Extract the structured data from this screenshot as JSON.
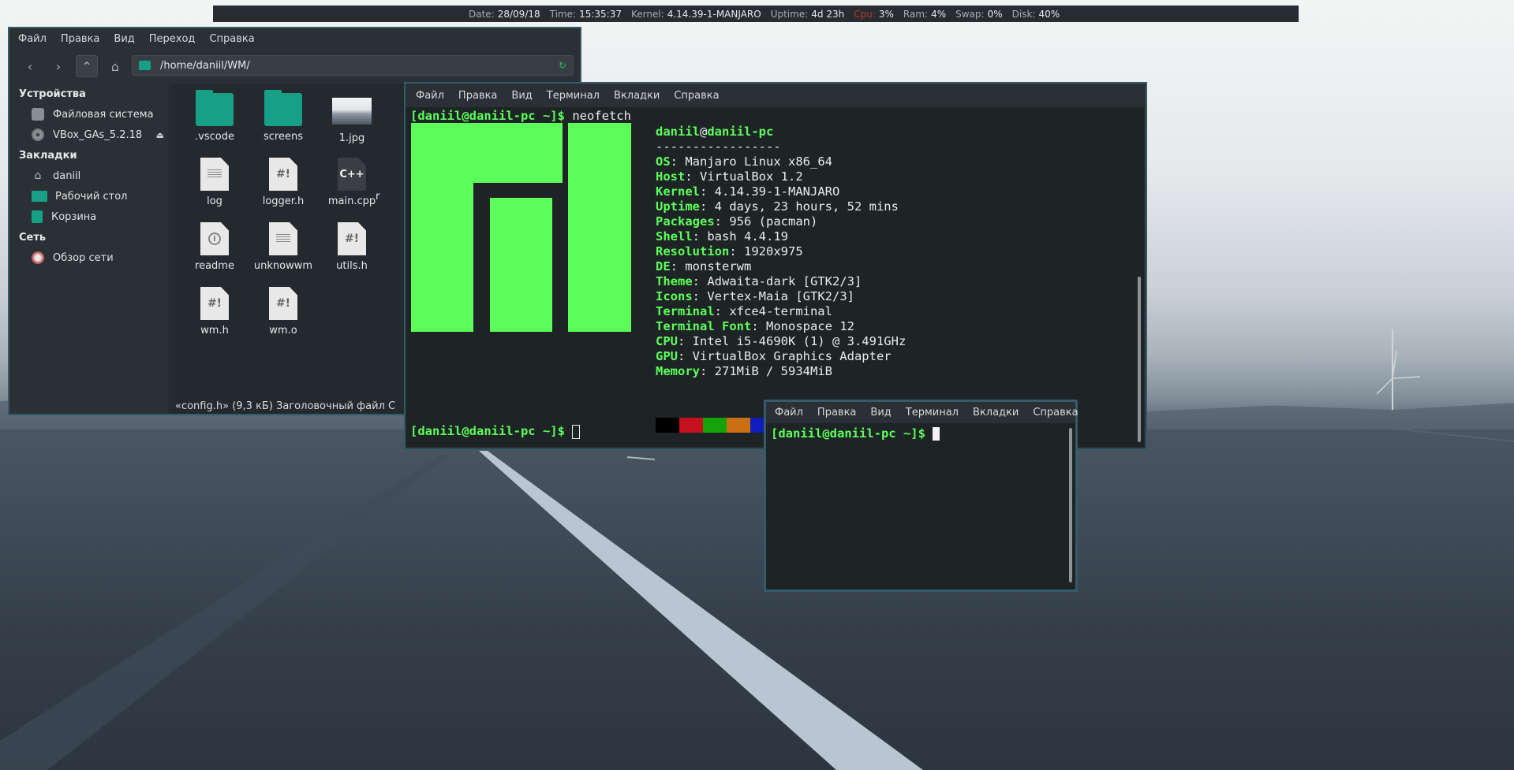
{
  "statusbar": {
    "date_label": "Date:",
    "date": "28/09/18",
    "time_label": "Time:",
    "time": "15:35:37",
    "kernel_label": "Kernel:",
    "kernel": "4.14.39-1-MANJARO",
    "uptime_label": "Uptime:",
    "uptime": "4d 23h",
    "cpu_label": "Cpu:",
    "cpu": "3%",
    "ram_label": "Ram:",
    "ram": "4%",
    "swap_label": "Swap:",
    "swap": "0%",
    "disk_label": "Disk:",
    "disk": "40%",
    "colors": {
      "background": "#272c31",
      "cpu_label": "#b8382f"
    }
  },
  "file_manager": {
    "menu": [
      "Файл",
      "Правка",
      "Вид",
      "Переход",
      "Справка"
    ],
    "toolbar_icons": [
      "back-icon",
      "forward-icon",
      "up-icon",
      "home-icon"
    ],
    "path": "/home/daniil/WM/",
    "sidebar": {
      "devices_title": "Устройства",
      "devices": [
        {
          "label": "Файловая система",
          "icon": "disk-icon"
        },
        {
          "label": "VBox_GAs_5.2.18",
          "icon": "cdrom-icon"
        }
      ],
      "bookmarks_title": "Закладки",
      "bookmarks": [
        {
          "label": "daniil",
          "icon": "home-icon"
        },
        {
          "label": "Рабочий стол",
          "icon": "desktop-icon"
        },
        {
          "label": "Корзина",
          "icon": "trash-icon"
        }
      ],
      "network_title": "Сеть",
      "network": [
        {
          "label": "Обзор сети",
          "icon": "network-icon"
        }
      ]
    },
    "files": [
      {
        "name": ".vscode",
        "icon": "folder-icon"
      },
      {
        "name": "screens",
        "icon": "folder-icon"
      },
      {
        "name": "1.jpg",
        "icon": "image-icon"
      },
      {
        "name": "log",
        "icon": "text-file-icon"
      },
      {
        "name": "logger.h",
        "icon": "script-file-icon",
        "glyph": "#!"
      },
      {
        "name": "main.cpp",
        "icon": "cpp-file-icon",
        "glyph": "C++"
      },
      {
        "name": "readme",
        "icon": "info-file-icon"
      },
      {
        "name": "unknowwm",
        "icon": "text-file-icon"
      },
      {
        "name": "utils.h",
        "icon": "script-file-icon",
        "glyph": "#!"
      },
      {
        "name": "wm.h",
        "icon": "script-file-icon",
        "glyph": "#!"
      },
      {
        "name": "wm.o",
        "icon": "script-file-icon",
        "glyph": "#!"
      }
    ],
    "partial_label": "r",
    "status": "«config.h» (9,3 кБ) Заголовочный файл C"
  },
  "terminal_main": {
    "menu": [
      "Файл",
      "Правка",
      "Вид",
      "Терминал",
      "Вкладки",
      "Справка"
    ],
    "prompt": "[daniil@daniil-pc ~]$",
    "command": "neofetch",
    "neofetch": {
      "user": "daniil",
      "at": "@",
      "host": "daniil-pc",
      "separator": "-----------------",
      "fields": [
        {
          "key": "OS",
          "value": "Manjaro Linux x86_64"
        },
        {
          "key": "Host",
          "value": "VirtualBox 1.2"
        },
        {
          "key": "Kernel",
          "value": "4.14.39-1-MANJARO"
        },
        {
          "key": "Uptime",
          "value": "4 days, 23 hours, 52 mins"
        },
        {
          "key": "Packages",
          "value": "956 (pacman)"
        },
        {
          "key": "Shell",
          "value": "bash 4.4.19"
        },
        {
          "key": "Resolution",
          "value": "1920x975"
        },
        {
          "key": "DE",
          "value": "monsterwm"
        },
        {
          "key": "Theme",
          "value": "Adwaita-dark [GTK2/3]"
        },
        {
          "key": "Icons",
          "value": "Vertex-Maia [GTK2/3]"
        },
        {
          "key": "Terminal",
          "value": "xfce4-terminal"
        },
        {
          "key": "Terminal Font",
          "value": "Monospace 12"
        },
        {
          "key": "CPU",
          "value": "Intel i5-4690K (1) @ 3.491GHz"
        },
        {
          "key": "GPU",
          "value": "VirtualBox Graphics Adapter"
        },
        {
          "key": "Memory",
          "value": "271MiB / 5934MiB"
        }
      ],
      "logo_color": "#5cff5a",
      "palette": [
        "#000000",
        "#c4111b",
        "#14a30a",
        "#c97013",
        "#101eb9",
        "#b41ebe",
        "#17b3b8",
        "#b9b9b9"
      ]
    },
    "prompt_final": "[daniil@daniil-pc ~]$"
  },
  "terminal_small": {
    "menu": [
      "Файл",
      "Правка",
      "Вид",
      "Терминал",
      "Вкладки",
      "Справка"
    ],
    "prompt": "[daniil@daniil-pc ~]$"
  }
}
